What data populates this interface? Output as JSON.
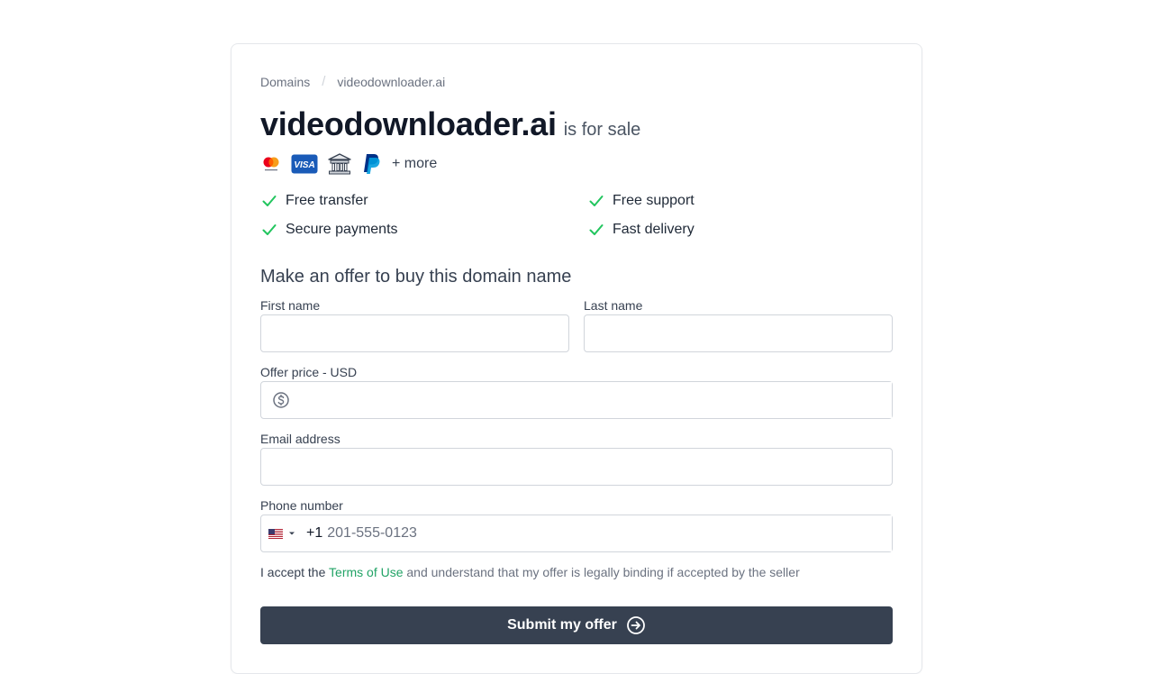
{
  "breadcrumb": {
    "root": "Domains",
    "separator": "/",
    "current": "videodownloader.ai"
  },
  "headline": {
    "domain": "videodownloader.ai",
    "suffix": "is for sale"
  },
  "payments": {
    "icons": [
      "mastercard-icon",
      "visa-icon",
      "bank-icon",
      "paypal-icon"
    ],
    "more_label": "+ more"
  },
  "features": [
    "Free transfer",
    "Free support",
    "Secure payments",
    "Fast delivery"
  ],
  "form": {
    "title": "Make an offer to buy this domain name",
    "first_name_label": "First name",
    "first_name_value": "",
    "last_name_label": "Last name",
    "last_name_value": "",
    "price_label": "Offer price - USD",
    "price_value": "",
    "email_label": "Email address",
    "email_value": "",
    "phone_label": "Phone number",
    "phone_country": "US",
    "phone_dial_code": "+1",
    "phone_placeholder": "201-555-0123",
    "terms_lead": "I accept the",
    "terms_link": "Terms of Use",
    "terms_tail": "and understand that my offer is legally binding if accepted by the seller",
    "submit_label": "Submit my offer"
  },
  "colors": {
    "check_green": "#22c55e",
    "link_green": "#22a366",
    "button_bg": "#374151"
  }
}
